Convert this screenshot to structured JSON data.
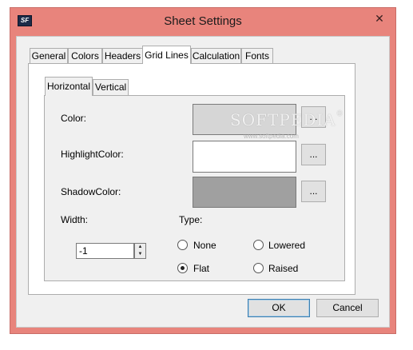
{
  "window": {
    "title": "Sheet Settings",
    "app_icon_text": "SF",
    "close_glyph": "✕",
    "frame_color": "#e8847c"
  },
  "tabs": [
    {
      "label": "General",
      "active": false
    },
    {
      "label": "Colors",
      "active": false
    },
    {
      "label": "Headers",
      "active": false
    },
    {
      "label": "Grid Lines",
      "active": true
    },
    {
      "label": "Calculation",
      "active": false
    },
    {
      "label": "Fonts",
      "active": false
    }
  ],
  "inner_tabs": [
    {
      "label": "Horizontal",
      "active": true
    },
    {
      "label": "Vertical",
      "active": false
    }
  ],
  "colors": {
    "color": {
      "label": "Color:",
      "value": "#d6d6d6",
      "button": "..."
    },
    "highlight": {
      "label": "HighlightColor:",
      "value": "#ffffff",
      "button": "..."
    },
    "shadow": {
      "label": "ShadowColor:",
      "value": "#a0a0a0",
      "button": "..."
    }
  },
  "width": {
    "label": "Width:",
    "value": "-1"
  },
  "type": {
    "label": "Type:",
    "options": [
      {
        "label": "None",
        "checked": false
      },
      {
        "label": "Lowered",
        "checked": false
      },
      {
        "label": "Flat",
        "checked": true
      },
      {
        "label": "Raised",
        "checked": false
      }
    ]
  },
  "buttons": {
    "ok": "OK",
    "cancel": "Cancel"
  },
  "watermark": {
    "text": "SOFTPEDIA",
    "trademark": "®",
    "url": "www.softpedia.com"
  }
}
